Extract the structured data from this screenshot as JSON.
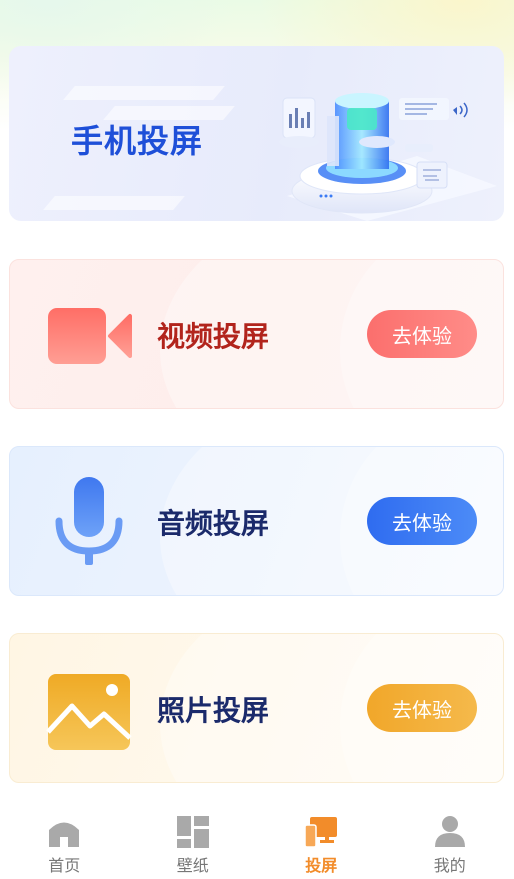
{
  "banner": {
    "title": "手机投屏"
  },
  "cards": [
    {
      "label": "视频投屏",
      "button": "去体验",
      "icon": "video-camera-icon",
      "accent": "#fb6f6d"
    },
    {
      "label": "音频投屏",
      "button": "去体验",
      "icon": "microphone-icon",
      "accent": "#2f6cf0"
    },
    {
      "label": "照片投屏",
      "button": "去体验",
      "icon": "image-icon",
      "accent": "#f1a72a"
    }
  ],
  "tabbar": {
    "items": [
      {
        "label": "首页",
        "icon": "home-icon",
        "active": false
      },
      {
        "label": "壁纸",
        "icon": "wallpaper-grid-icon",
        "active": false
      },
      {
        "label": "投屏",
        "icon": "screen-cast-icon",
        "active": true
      },
      {
        "label": "我的",
        "icon": "profile-icon",
        "active": false
      }
    ],
    "active_color": "#f28c2a",
    "inactive_color": "#a9a9a9"
  }
}
